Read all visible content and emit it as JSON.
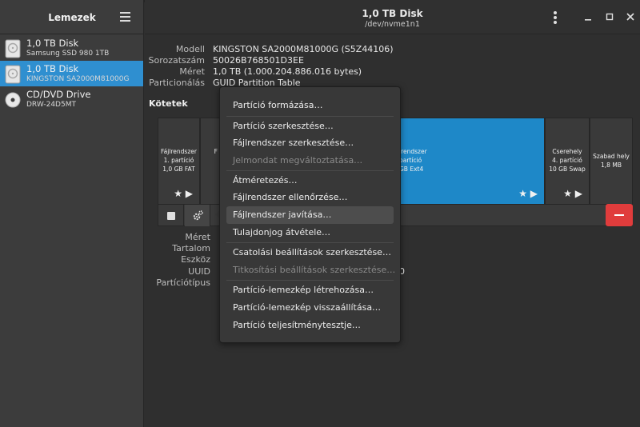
{
  "sidebar": {
    "title": "Lemezek",
    "disks": [
      {
        "name": "1,0 TB Disk",
        "subtitle": "Samsung SSD 980 1TB"
      },
      {
        "name": "1,0 TB Disk",
        "subtitle": "KINGSTON SA2000M81000G"
      },
      {
        "name": "CD/DVD Drive",
        "subtitle": "DRW-24D5MT"
      }
    ]
  },
  "header": {
    "title": "1,0 TB Disk",
    "subtitle": "/dev/nvme1n1"
  },
  "drive_info": {
    "model_label": "Modell",
    "model_value": "KINGSTON SA2000M81000G (S5Z44106)",
    "serial_label": "Sorozatszám",
    "serial_value": "50026B768501D3EE",
    "size_label": "Méret",
    "size_value": "1,0 TB (1.000.204.886.016 bytes)",
    "partitioning_label": "Particionálás",
    "partitioning_value": "GUID Partition Table"
  },
  "volumes_title": "Kötetek",
  "partitions": {
    "p1": {
      "line1": "Fájlrendszer",
      "line2": "1. partíció",
      "line3": "1,0 GB FAT"
    },
    "p2": {
      "line1": "F",
      "line2": "",
      "line3": ""
    },
    "p3": {
      "line1": "lrendszer",
      "line2": "partíció",
      "line3": "GB Ext4"
    },
    "swap": {
      "line1": "Cserehely",
      "line2": "4. partíció",
      "line3": "10 GB Swap"
    },
    "free": {
      "line1": "Szabad hely",
      "line2": "1,8 MB"
    }
  },
  "details": {
    "size_label": "Méret",
    "content_label": "Tartalom",
    "device_label": "Eszköz",
    "uuid_label": "UUID",
    "parttype_label": "Partíciótípus",
    "uuid_fragment": "0"
  },
  "menu": {
    "items": [
      "Partíció formázása…",
      "Partíció szerkesztése…",
      "Fájlrendszer szerkesztése…",
      "Jelmondat megváltoztatása…",
      "Átméretezés…",
      "Fájlrendszer ellenőrzése…",
      "Fájlrendszer javítása…",
      "Tulajdonjog átvétele…",
      "Csatolási beállítások szerkesztése…",
      "Titkosítási beállítások szerkesztése…",
      "Partíció-lemezkép létrehozása…",
      "Partíció-lemezkép visszaállítása…",
      "Partíció teljesítménytesztje…"
    ]
  },
  "colors": {
    "accent": "#2f8fd0",
    "partition": "#1e88c8",
    "danger": "#e03c3c"
  }
}
